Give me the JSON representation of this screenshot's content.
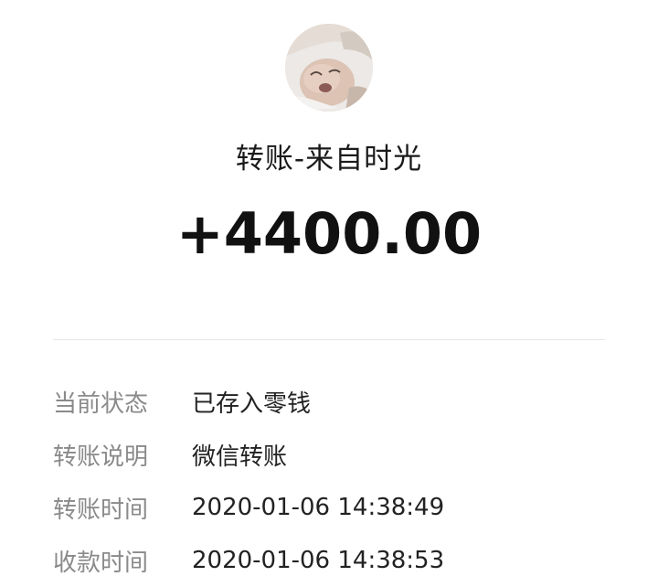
{
  "header": {
    "avatar": "avatar-photo",
    "title": "转账-来自时光",
    "amount": "+4400.00"
  },
  "details": [
    {
      "label": "当前状态",
      "value": "已存入零钱"
    },
    {
      "label": "转账说明",
      "value": "微信转账"
    },
    {
      "label": "转账时间",
      "value": "2020-01-06 14:38:49"
    },
    {
      "label": "收款时间",
      "value": "2020-01-06 14:38:53"
    }
  ]
}
